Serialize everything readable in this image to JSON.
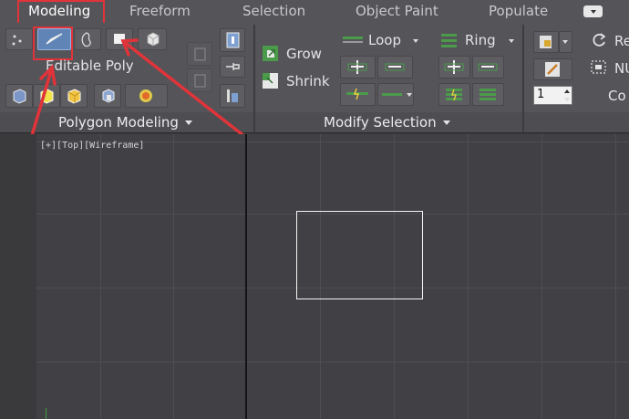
{
  "tabs": {
    "items": [
      {
        "label": "Modeling",
        "active": true
      },
      {
        "label": "Freeform",
        "active": false
      },
      {
        "label": "Selection",
        "active": false
      },
      {
        "label": "Object Paint",
        "active": false
      },
      {
        "label": "Populate",
        "active": false
      }
    ],
    "options_icon": "ribbon-options-icon"
  },
  "polygon_modeling": {
    "object_label": "Editable Poly",
    "panel_title": "Polygon Modeling",
    "subobject_icons": [
      "vertex-icon",
      "edge-icon",
      "border-icon",
      "polygon-icon",
      "element-icon"
    ],
    "tool_icons": [
      "modify-mode-icon",
      "preview-icon",
      "isolate-icon",
      "use-soft-selection-icon",
      "display-icon"
    ]
  },
  "modify_selection": {
    "panel_title": "Modify Selection",
    "grow_label": "Grow",
    "shrink_label": "Shrink",
    "loop_label": "Loop",
    "ring_label": "Ring"
  },
  "edit_panel": {
    "repeat_label_partial": "Re",
    "nurms_label_partial": "NU",
    "constraint_label_partial": "Co",
    "spinner_value": "1"
  },
  "viewport": {
    "label": "[+][Top][Wireframe]"
  },
  "colors": {
    "accent_red": "#e0343a",
    "ribbon_bg": "#545459",
    "viewport_bg": "#414145"
  }
}
